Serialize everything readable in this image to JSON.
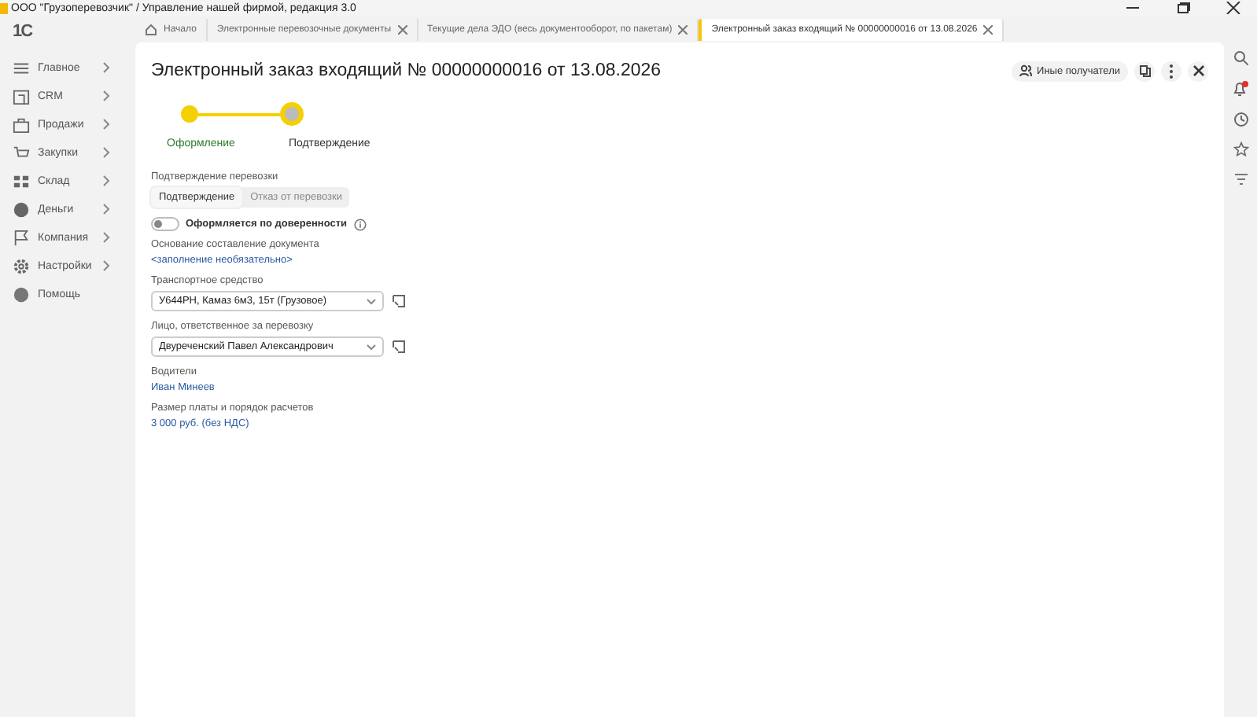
{
  "window": {
    "title": "ООО \"Грузоперевозчик\" / Управление нашей фирмой, редакция 3.0",
    "logo": "1С"
  },
  "sidebar": {
    "items": [
      {
        "label": "Главное"
      },
      {
        "label": "CRM"
      },
      {
        "label": "Продажи"
      },
      {
        "label": "Закупки"
      },
      {
        "label": "Склад"
      },
      {
        "label": "Деньги"
      },
      {
        "label": "Компания"
      },
      {
        "label": "Настройки"
      },
      {
        "label": "Помощь"
      }
    ]
  },
  "tabs": [
    {
      "label": "Начало",
      "selected": false
    },
    {
      "label": "Электронные перевозочные документы",
      "selected": false
    },
    {
      "label": "Текущие дела ЭДО (весь документооборот, по пакетам)",
      "selected": false
    },
    {
      "label": "Электронный заказ входящий № 00000000016 от 13.08.2026",
      "selected": true
    }
  ],
  "form": {
    "title": "Электронный заказ входящий № 00000000016 от 13.08.2026",
    "other_recipients": "Иные получатели",
    "steps": [
      {
        "label": "Оформление",
        "done": true
      },
      {
        "label": "Подтверждение",
        "done": false
      }
    ],
    "confirm_label": "Подтверждение перевозки",
    "segments": [
      {
        "label": "Подтверждение",
        "selected": true
      },
      {
        "label": "Отказ от перевозки",
        "selected": false
      }
    ],
    "toggle": {
      "label": "Оформляется по доверенности",
      "on": false
    },
    "fields": [
      {
        "kind": "link",
        "label": "Основание составление документа",
        "value": "<заполнение необязательно>"
      },
      {
        "kind": "select",
        "label": "Транспортное средство",
        "value": "У644РН, Камаз  6м3, 15т (Грузовое)"
      },
      {
        "kind": "select",
        "label": "Лицо, ответственное за перевозку",
        "value": "Двуреченский Павел Александрович"
      },
      {
        "kind": "link",
        "label": "Водители",
        "value": "Иван Минеев"
      },
      {
        "kind": "link",
        "label": "Размер платы и порядок расчетов",
        "value": "3 000 руб. (без НДС)"
      }
    ]
  }
}
